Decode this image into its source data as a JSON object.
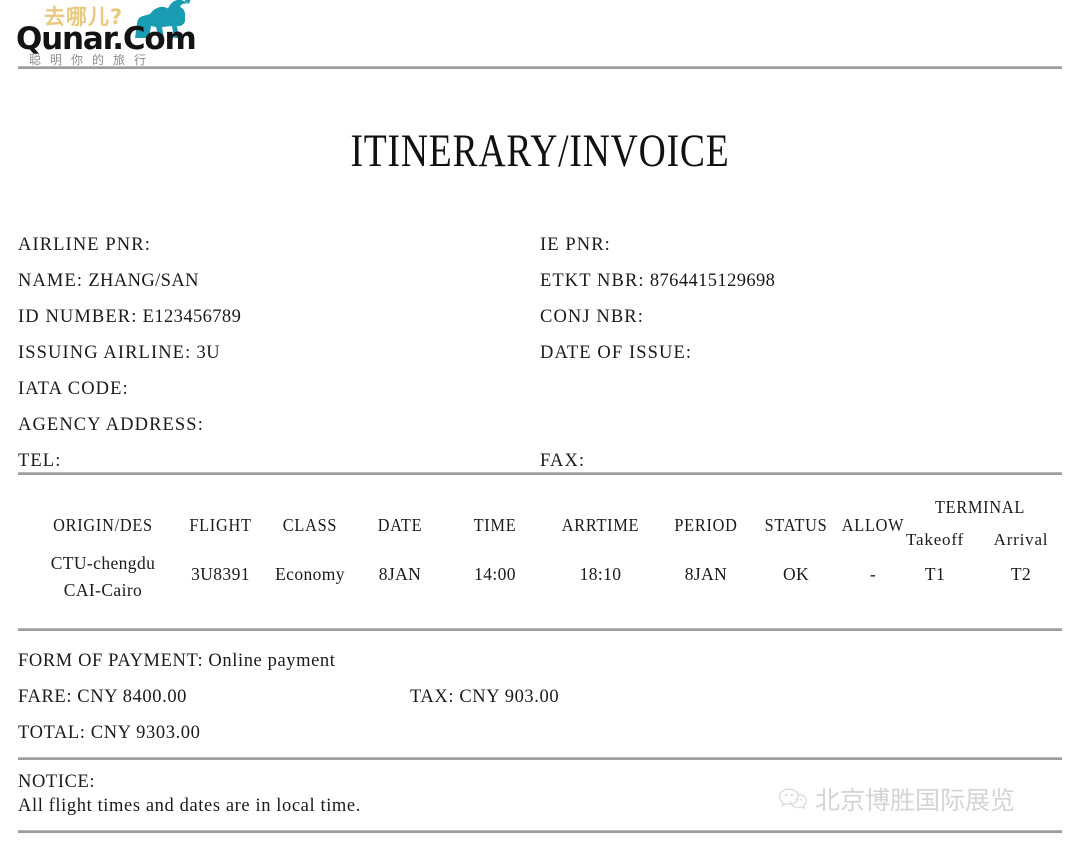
{
  "brand": {
    "cn_question": "去哪儿?",
    "wordmark": "Qunar.Com",
    "tagline": "聪明你的旅行",
    "camel_icon": "camel-icon",
    "camel_color": "#1a9cb2",
    "question_color": "#e9c97e"
  },
  "document": {
    "title": "ITINERARY/INVOICE"
  },
  "info": {
    "left": [
      {
        "label": "AIRLINE PNR:",
        "value": ""
      },
      {
        "label": "NAME:",
        "value": "ZHANG/SAN"
      },
      {
        "label": "ID NUMBER:",
        "value": "E123456789"
      },
      {
        "label": "ISSUING AIRLINE:",
        "value": "3U"
      },
      {
        "label": "IATA CODE:",
        "value": ""
      },
      {
        "label": "AGENCY ADDRESS:",
        "value": ""
      },
      {
        "label": "TEL:",
        "value": ""
      }
    ],
    "right": [
      {
        "label": "IE PNR:",
        "value": ""
      },
      {
        "label": "ETKT NBR:",
        "value": "8764415129698"
      },
      {
        "label": "CONJ NBR:",
        "value": ""
      },
      {
        "label": "DATE OF ISSUE:",
        "value": ""
      },
      {
        "label": "",
        "value": ""
      },
      {
        "label": "",
        "value": ""
      },
      {
        "label": "FAX:",
        "value": ""
      }
    ]
  },
  "flight_table": {
    "headers": {
      "origin_des": "ORIGIN/DES",
      "flight": "FLIGHT",
      "class": "CLASS",
      "date": "DATE",
      "time": "TIME",
      "arrtime": "ARRTIME",
      "period": "PERIOD",
      "status": "STATUS",
      "allow": "ALLOW",
      "terminal": "TERMINAL",
      "terminal_takeoff": "Takeoff",
      "terminal_arrival": "Arrival"
    },
    "rows": [
      {
        "origin": "CTU-chengdu",
        "destination": "CAI-Cairo",
        "flight": "3U8391",
        "class": "Economy",
        "date": "8JAN",
        "time": "14:00",
        "arrtime": "18:10",
        "period": "8JAN",
        "status": "OK",
        "allow": "-",
        "terminal_takeoff": "T1",
        "terminal_arrival": "T2"
      }
    ]
  },
  "payment": {
    "form_label": "FORM OF PAYMENT:",
    "form_value": "Online payment",
    "fare_label": "FARE:",
    "fare_value": "CNY 8400.00",
    "tax_label": "TAX:",
    "tax_value": "CNY 903.00",
    "total_label": "TOTAL:",
    "total_value": "CNY 9303.00"
  },
  "notice": {
    "heading": "NOTICE:",
    "text": "All flight times and dates are in local time."
  },
  "watermark": {
    "icon": "wechat-icon",
    "text": "北京博胜国际展览"
  }
}
